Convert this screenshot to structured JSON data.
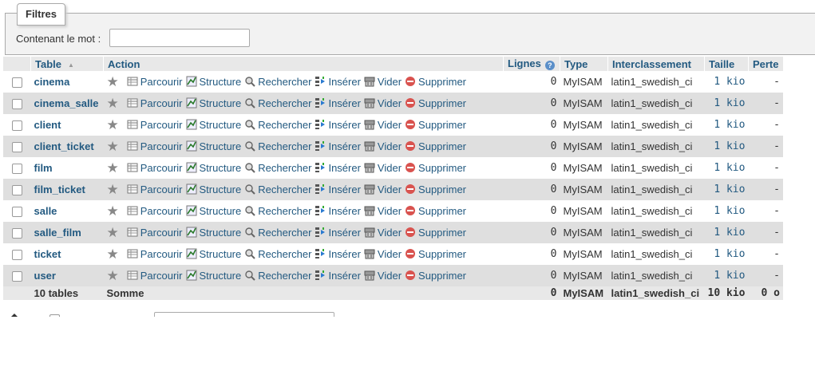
{
  "filters": {
    "legend": "Filtres",
    "label": "Contenant le mot :",
    "input_value": ""
  },
  "headers": {
    "table": "Table",
    "action": "Action",
    "lignes": "Lignes",
    "type": "Type",
    "interclassement": "Interclassement",
    "taille": "Taille",
    "perte": "Perte"
  },
  "actions": {
    "parcourir": "Parcourir",
    "structure": "Structure",
    "rechercher": "Rechercher",
    "inserer": "Insérer",
    "vider": "Vider",
    "supprimer": "Supprimer"
  },
  "rows": [
    {
      "name": "cinema",
      "rows": "0",
      "type": "MyISAM",
      "collation": "latin1_swedish_ci",
      "size": "1 kio",
      "overhead": "-"
    },
    {
      "name": "cinema_salle",
      "rows": "0",
      "type": "MyISAM",
      "collation": "latin1_swedish_ci",
      "size": "1 kio",
      "overhead": "-"
    },
    {
      "name": "client",
      "rows": "0",
      "type": "MyISAM",
      "collation": "latin1_swedish_ci",
      "size": "1 kio",
      "overhead": "-"
    },
    {
      "name": "client_ticket",
      "rows": "0",
      "type": "MyISAM",
      "collation": "latin1_swedish_ci",
      "size": "1 kio",
      "overhead": "-"
    },
    {
      "name": "film",
      "rows": "0",
      "type": "MyISAM",
      "collation": "latin1_swedish_ci",
      "size": "1 kio",
      "overhead": "-"
    },
    {
      "name": "film_ticket",
      "rows": "0",
      "type": "MyISAM",
      "collation": "latin1_swedish_ci",
      "size": "1 kio",
      "overhead": "-"
    },
    {
      "name": "salle",
      "rows": "0",
      "type": "MyISAM",
      "collation": "latin1_swedish_ci",
      "size": "1 kio",
      "overhead": "-"
    },
    {
      "name": "salle_film",
      "rows": "0",
      "type": "MyISAM",
      "collation": "latin1_swedish_ci",
      "size": "1 kio",
      "overhead": "-"
    },
    {
      "name": "ticket",
      "rows": "0",
      "type": "MyISAM",
      "collation": "latin1_swedish_ci",
      "size": "1 kio",
      "overhead": "-"
    },
    {
      "name": "user",
      "rows": "0",
      "type": "MyISAM",
      "collation": "latin1_swedish_ci",
      "size": "1 kio",
      "overhead": "-"
    }
  ],
  "footer": {
    "count": "10 tables",
    "label": "Somme",
    "rows": "0",
    "type": "MyISAM",
    "collation": "latin1_swedish_ci",
    "size": "10 kio",
    "overhead": "0 o"
  },
  "colors": {
    "link": "#235a81",
    "row_even": "#dfdfdf",
    "header_bg": "#e8e8e8",
    "delete": "#d9534f"
  }
}
